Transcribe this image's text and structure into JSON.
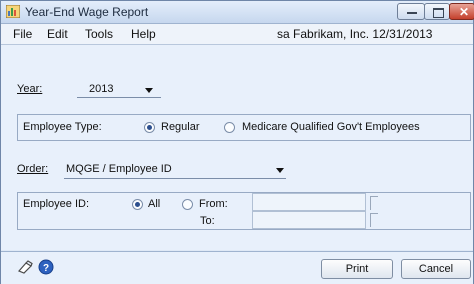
{
  "window": {
    "title": "Year-End Wage Report"
  },
  "menubar": {
    "file": "File",
    "edit": "Edit",
    "tools": "Tools",
    "help": "Help",
    "user": "sa",
    "company": "Fabrikam, Inc.",
    "date": "12/31/2013"
  },
  "year": {
    "label": "Year:",
    "value": "2013"
  },
  "employee_type": {
    "label": "Employee Type:",
    "options": [
      "Regular",
      "Medicare Qualified Gov't Employees"
    ],
    "selected": "Regular"
  },
  "order": {
    "label": "Order:",
    "value": "MQGE / Employee ID"
  },
  "employee_id": {
    "label": "Employee ID:",
    "all_label": "All",
    "from_label": "From:",
    "to_label": "To:",
    "selected": "All"
  },
  "buttons": {
    "print": "Print",
    "cancel": "Cancel"
  },
  "icons": {
    "app": "wage-report-icon",
    "note": "note-icon",
    "help": "help-icon"
  }
}
